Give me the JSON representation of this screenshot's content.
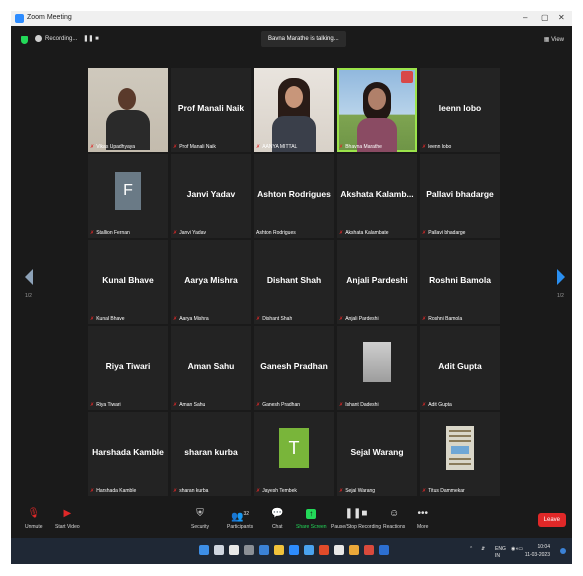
{
  "window": {
    "title": "Zoom Meeting",
    "controls": [
      "–",
      "▢",
      "✕"
    ]
  },
  "topbar": {
    "recording_label": "Recording...",
    "recording_controls": "❚❚ ■",
    "talking": "Bavna Marathe is talking...",
    "view_label": "View"
  },
  "participants": [
    {
      "display": "",
      "label": "Vikas Upadhyaya",
      "type": "video-man"
    },
    {
      "display": "Prof Manali Naik",
      "label": "Prof Manali Naik",
      "type": "name"
    },
    {
      "display": "",
      "label": "AANYA MITTAL",
      "type": "video-woman"
    },
    {
      "display": "",
      "label": "Bhavna Marathe",
      "type": "video-bhavna",
      "active": true
    },
    {
      "display": "leenn lobo",
      "label": "leenn lobo",
      "type": "name"
    },
    {
      "display": "F",
      "label": "Stallion Fernan",
      "type": "avatar-f"
    },
    {
      "display": "Janvi Yadav",
      "label": "Janvi Yadav",
      "type": "name"
    },
    {
      "display": "Ashton Rodrigues",
      "label": "Ashton Rodrigues",
      "type": "name",
      "unmuted": true
    },
    {
      "display": "Akshata  Kalamb...",
      "label": "Akshata Kalambate",
      "type": "name"
    },
    {
      "display": "Pallavi bhadarge",
      "label": "Pallavi bhadarge",
      "type": "name"
    },
    {
      "display": "Kunal Bhave",
      "label": "Kunal Bhave",
      "type": "name"
    },
    {
      "display": "Aarya Mishra",
      "label": "Aarya Mishra",
      "type": "name"
    },
    {
      "display": "Dishant Shah",
      "label": "Dishant Shah",
      "type": "name"
    },
    {
      "display": "Anjali Pardeshi",
      "label": "Anjali Pardeshi",
      "type": "name"
    },
    {
      "display": "Roshni Bamola",
      "label": "Roshni Bamola",
      "type": "name"
    },
    {
      "display": "Riya Tiwari",
      "label": "Riya Tiwari",
      "type": "name"
    },
    {
      "display": "Aman Sahu",
      "label": "Aman Sahu",
      "type": "name"
    },
    {
      "display": "Ganesh Pradhan",
      "label": "Ganesh Pradhan",
      "type": "name"
    },
    {
      "display": "",
      "label": "Ishant Dadeshi",
      "type": "grey-image"
    },
    {
      "display": "Adit Gupta",
      "label": "Adit Gupta",
      "type": "name"
    },
    {
      "display": "Harshada Kamble",
      "label": "Harshada Kamble",
      "type": "name"
    },
    {
      "display": "sharan kurba",
      "label": "sharan kurba",
      "type": "name"
    },
    {
      "display": "T",
      "label": "Jayesh Tembek",
      "type": "avatar-t"
    },
    {
      "display": "Sejal Warang",
      "label": "Sejal Warang",
      "type": "name"
    },
    {
      "display": "",
      "label": "Titus Dammekar",
      "type": "paper-image"
    }
  ],
  "pager": {
    "left": "1/2",
    "right": "1/2"
  },
  "toolbar": {
    "unmute": "Unmute",
    "start_video": "Start Video",
    "security": "Security",
    "participants": "Participants",
    "participants_count": "32",
    "chat": "Chat",
    "share_screen": "Share Screen",
    "pause_recording": "Pause/Stop Recording",
    "reactions": "Reactions",
    "more": "More",
    "leave": "Leave"
  },
  "taskbar": {
    "lang_top": "ENG",
    "lang_bottom": "IN",
    "time": "10:04",
    "date": "11-03-2023"
  },
  "colors": {
    "accent_green": "#23d959",
    "leave_red": "#e02828",
    "arrow_blue": "#2a8ff0"
  }
}
